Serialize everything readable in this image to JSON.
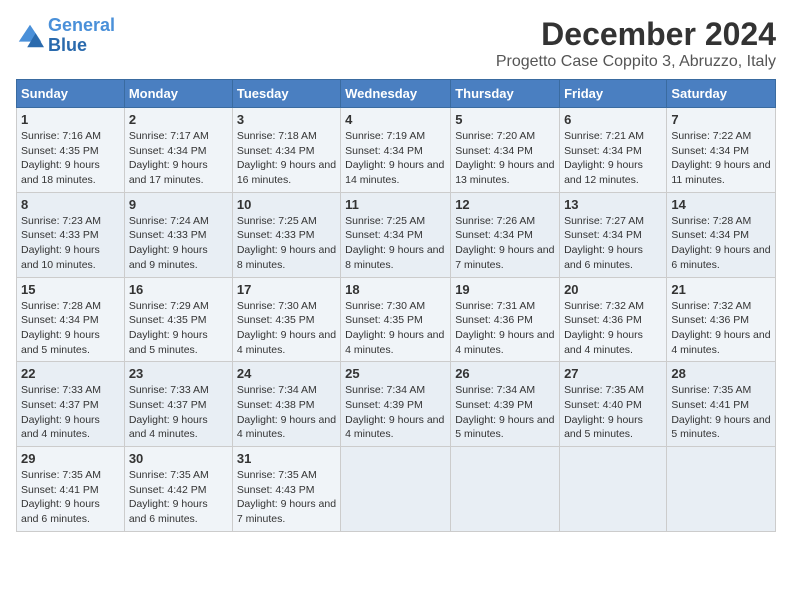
{
  "header": {
    "logo_line1": "General",
    "logo_line2": "Blue",
    "title": "December 2024",
    "subtitle": "Progetto Case Coppito 3, Abruzzo, Italy"
  },
  "weekdays": [
    "Sunday",
    "Monday",
    "Tuesday",
    "Wednesday",
    "Thursday",
    "Friday",
    "Saturday"
  ],
  "weeks": [
    [
      {
        "day": "1",
        "sunrise": "7:16 AM",
        "sunset": "4:35 PM",
        "daylight": "9 hours and 18 minutes."
      },
      {
        "day": "2",
        "sunrise": "7:17 AM",
        "sunset": "4:34 PM",
        "daylight": "9 hours and 17 minutes."
      },
      {
        "day": "3",
        "sunrise": "7:18 AM",
        "sunset": "4:34 PM",
        "daylight": "9 hours and 16 minutes."
      },
      {
        "day": "4",
        "sunrise": "7:19 AM",
        "sunset": "4:34 PM",
        "daylight": "9 hours and 14 minutes."
      },
      {
        "day": "5",
        "sunrise": "7:20 AM",
        "sunset": "4:34 PM",
        "daylight": "9 hours and 13 minutes."
      },
      {
        "day": "6",
        "sunrise": "7:21 AM",
        "sunset": "4:34 PM",
        "daylight": "9 hours and 12 minutes."
      },
      {
        "day": "7",
        "sunrise": "7:22 AM",
        "sunset": "4:34 PM",
        "daylight": "9 hours and 11 minutes."
      }
    ],
    [
      {
        "day": "8",
        "sunrise": "7:23 AM",
        "sunset": "4:33 PM",
        "daylight": "9 hours and 10 minutes."
      },
      {
        "day": "9",
        "sunrise": "7:24 AM",
        "sunset": "4:33 PM",
        "daylight": "9 hours and 9 minutes."
      },
      {
        "day": "10",
        "sunrise": "7:25 AM",
        "sunset": "4:33 PM",
        "daylight": "9 hours and 8 minutes."
      },
      {
        "day": "11",
        "sunrise": "7:25 AM",
        "sunset": "4:34 PM",
        "daylight": "9 hours and 8 minutes."
      },
      {
        "day": "12",
        "sunrise": "7:26 AM",
        "sunset": "4:34 PM",
        "daylight": "9 hours and 7 minutes."
      },
      {
        "day": "13",
        "sunrise": "7:27 AM",
        "sunset": "4:34 PM",
        "daylight": "9 hours and 6 minutes."
      },
      {
        "day": "14",
        "sunrise": "7:28 AM",
        "sunset": "4:34 PM",
        "daylight": "9 hours and 6 minutes."
      }
    ],
    [
      {
        "day": "15",
        "sunrise": "7:28 AM",
        "sunset": "4:34 PM",
        "daylight": "9 hours and 5 minutes."
      },
      {
        "day": "16",
        "sunrise": "7:29 AM",
        "sunset": "4:35 PM",
        "daylight": "9 hours and 5 minutes."
      },
      {
        "day": "17",
        "sunrise": "7:30 AM",
        "sunset": "4:35 PM",
        "daylight": "9 hours and 4 minutes."
      },
      {
        "day": "18",
        "sunrise": "7:30 AM",
        "sunset": "4:35 PM",
        "daylight": "9 hours and 4 minutes."
      },
      {
        "day": "19",
        "sunrise": "7:31 AM",
        "sunset": "4:36 PM",
        "daylight": "9 hours and 4 minutes."
      },
      {
        "day": "20",
        "sunrise": "7:32 AM",
        "sunset": "4:36 PM",
        "daylight": "9 hours and 4 minutes."
      },
      {
        "day": "21",
        "sunrise": "7:32 AM",
        "sunset": "4:36 PM",
        "daylight": "9 hours and 4 minutes."
      }
    ],
    [
      {
        "day": "22",
        "sunrise": "7:33 AM",
        "sunset": "4:37 PM",
        "daylight": "9 hours and 4 minutes."
      },
      {
        "day": "23",
        "sunrise": "7:33 AM",
        "sunset": "4:37 PM",
        "daylight": "9 hours and 4 minutes."
      },
      {
        "day": "24",
        "sunrise": "7:34 AM",
        "sunset": "4:38 PM",
        "daylight": "9 hours and 4 minutes."
      },
      {
        "day": "25",
        "sunrise": "7:34 AM",
        "sunset": "4:39 PM",
        "daylight": "9 hours and 4 minutes."
      },
      {
        "day": "26",
        "sunrise": "7:34 AM",
        "sunset": "4:39 PM",
        "daylight": "9 hours and 5 minutes."
      },
      {
        "day": "27",
        "sunrise": "7:35 AM",
        "sunset": "4:40 PM",
        "daylight": "9 hours and 5 minutes."
      },
      {
        "day": "28",
        "sunrise": "7:35 AM",
        "sunset": "4:41 PM",
        "daylight": "9 hours and 5 minutes."
      }
    ],
    [
      {
        "day": "29",
        "sunrise": "7:35 AM",
        "sunset": "4:41 PM",
        "daylight": "9 hours and 6 minutes."
      },
      {
        "day": "30",
        "sunrise": "7:35 AM",
        "sunset": "4:42 PM",
        "daylight": "9 hours and 6 minutes."
      },
      {
        "day": "31",
        "sunrise": "7:35 AM",
        "sunset": "4:43 PM",
        "daylight": "9 hours and 7 minutes."
      },
      null,
      null,
      null,
      null
    ]
  ]
}
